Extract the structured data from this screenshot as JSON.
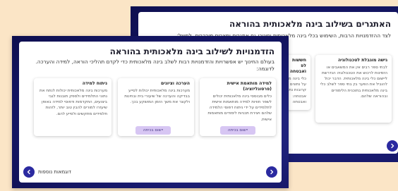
{
  "colors": {
    "page_bg": "#fbe5c6",
    "slide_bg": "#16186b",
    "pill_bg": "#d7c6f3",
    "nav_btn": "#2b2aa0"
  },
  "back_slide": {
    "title": "האתגרים בשילוב בינה מלאכותית בהוראה",
    "subtitle": "לצד ההזדמנויות הרבות, השימוש בכלי בינה מלאכותית יחינוכו גם אתגרים ומצבים מורכבים. למשל:",
    "cards": [
      {
        "title": "גישה מוגבלת לטכנולוגיה",
        "text": "לבתי ספר רבים אין את המשאבים או הזמינות לרכוש את הטכנולוגיה הנדרשת ליישום כלי בינה מלאכותית. הדבר יכול להוביל את הפער בין בתי ספר לשלב כלי בינה מלאכותית בתוכנית הלימודים ובהוראה שלהם."
      },
      {
        "title": "חששות לפ וֹאבטחה",
        "text": "כלי בינה מ על נתונים קרובות נתו אבטחה: ואבטחה"
      }
    ],
    "next_icon": "chevron-right-icon"
  },
  "front_slide": {
    "title": "הזדמנויות לשילוב בינה מלאכותית בהוראה",
    "subtitle": "בעולם החינוך יש אפשרויות והזדמנויות רבות לשלב בינה מלאכותית כדי לקדם תהליכי הוראה, למידה והערכה. לדוגמה:",
    "cards": [
      {
        "title": "למידה מותאמת אישית (פרסונליזציה)",
        "text": "כלים מבוססי בינה מלאכותית יכולים לשפר חוויות למידה מותאמות אישית לתלמידים על ידי ניתוח דפוסי הלמידה שלהם ויצירת תכניות לימודים מותאמות אישית.",
        "button": "יישום בכיתה"
      },
      {
        "title": "הערכה וציונים",
        "text": "מערכות בינה מלאכותית יכולות לסייע בבדיקה והערכה של שיעורי בית ובחינות ולקצר את משך הזמן המושקע בכך.",
        "button": "יישום בכיתה"
      },
      {
        "title": "ניתוח למידה",
        "text": "מערכות בינה מלאכותית יכולות לנתח את נתוני התלמידים ולספק תובנות לגבי ביצועים, התקדמות ודפוסי למידה באופן שיעזרו למורים להבין טוב יותר, לזהות תלמידים מתקשים ולסייע להם."
      }
    ],
    "more_link": "דוגמאות נוספות",
    "prev_icon": "chevron-left-icon",
    "next_icon": "chevron-right-icon"
  }
}
